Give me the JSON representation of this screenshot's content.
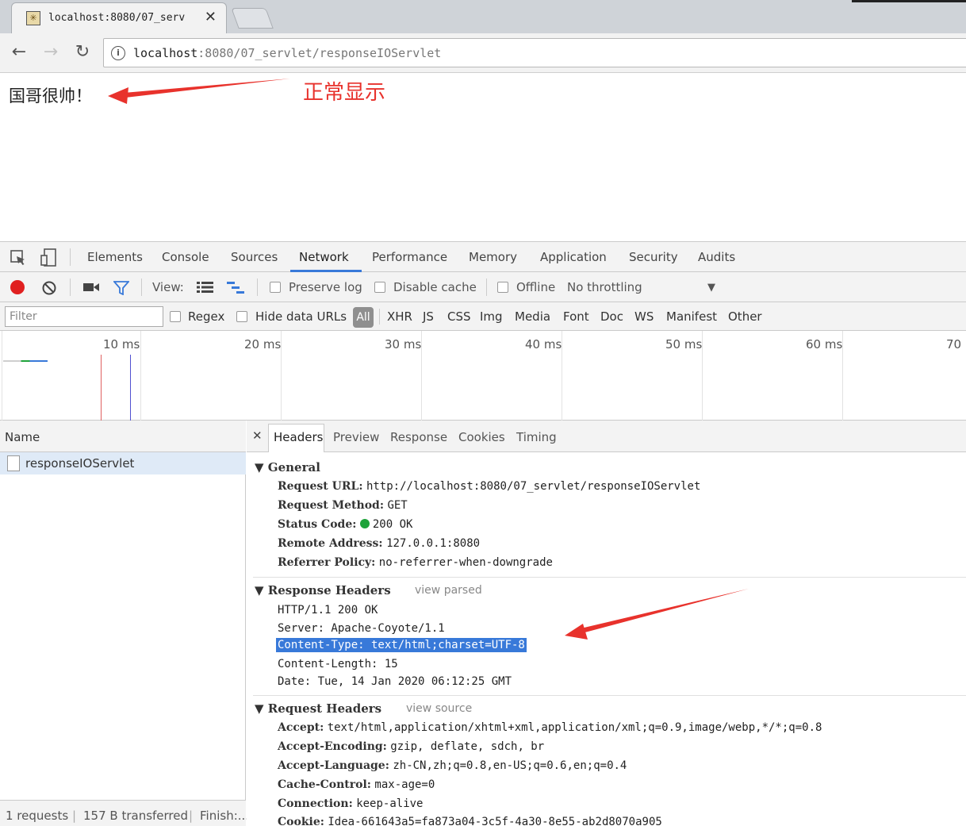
{
  "browser": {
    "tab_title": "localhost:8080/07_serv",
    "url_host": "localhost",
    "url_rest": ":8080/07_servlet/responseIOServlet"
  },
  "page": {
    "text": "国哥很帅！",
    "annotation": "正常显示"
  },
  "devtools": {
    "tabs": [
      "Elements",
      "Console",
      "Sources",
      "Network",
      "Performance",
      "Memory",
      "Application",
      "Security",
      "Audits"
    ],
    "active_tab": "Network",
    "controls": {
      "view_label": "View:",
      "preserve_log": "Preserve log",
      "disable_cache": "Disable cache",
      "offline": "Offline",
      "throttling": "No throttling"
    },
    "filter": {
      "placeholder": "Filter",
      "regex": "Regex",
      "hide_data_urls": "Hide data URLs",
      "all": "All",
      "types": [
        "XHR",
        "JS",
        "CSS",
        "Img",
        "Media",
        "Font",
        "Doc",
        "WS",
        "Manifest",
        "Other"
      ]
    },
    "timeline": [
      "10 ms",
      "20 ms",
      "30 ms",
      "40 ms",
      "50 ms",
      "60 ms",
      "70 ms"
    ],
    "requests": {
      "header": "Name",
      "items": [
        "responseIOServlet"
      ],
      "status": [
        "1 requests",
        "157 B transferred",
        "Finish:..."
      ]
    },
    "detail": {
      "tabs": [
        "Headers",
        "Preview",
        "Response",
        "Cookies",
        "Timing"
      ],
      "general": {
        "title": "General",
        "request_url": {
          "k": "Request URL:",
          "v": "http://localhost:8080/07_servlet/responseIOServlet"
        },
        "request_method": {
          "k": "Request Method:",
          "v": "GET"
        },
        "status_code": {
          "k": "Status Code:",
          "v": "200 OK"
        },
        "remote_address": {
          "k": "Remote Address:",
          "v": "127.0.0.1:8080"
        },
        "referrer_policy": {
          "k": "Referrer Policy:",
          "v": "no-referrer-when-downgrade"
        }
      },
      "response_headers": {
        "title": "Response Headers",
        "link": "view parsed",
        "lines": [
          "HTTP/1.1 200 OK",
          "Server: Apache-Coyote/1.1",
          "Content-Type: text/html;charset=UTF-8",
          "Content-Length: 15",
          "Date: Tue, 14 Jan 2020 06:12:25 GMT"
        ]
      },
      "request_headers": {
        "title": "Request Headers",
        "link": "view source",
        "accept": {
          "k": "Accept:",
          "v": "text/html,application/xhtml+xml,application/xml;q=0.9,image/webp,*/*;q=0.8"
        },
        "accept_encoding": {
          "k": "Accept-Encoding:",
          "v": "gzip, deflate, sdch, br"
        },
        "accept_language": {
          "k": "Accept-Language:",
          "v": "zh-CN,zh;q=0.8,en-US;q=0.6,en;q=0.4"
        },
        "cache_control": {
          "k": "Cache-Control:",
          "v": "max-age=0"
        },
        "connection": {
          "k": "Connection:",
          "v": "keep-alive"
        },
        "cookie": {
          "k": "Cookie:",
          "v": "Idea-661643a5=fa873a04-3c5f-4a30-8e55-ab2d8070a905"
        }
      }
    }
  },
  "colors": {
    "accent": "#3879d9",
    "annotation_red": "#e8322c",
    "record_red": "#e02020",
    "status_green": "#1fa33b"
  }
}
